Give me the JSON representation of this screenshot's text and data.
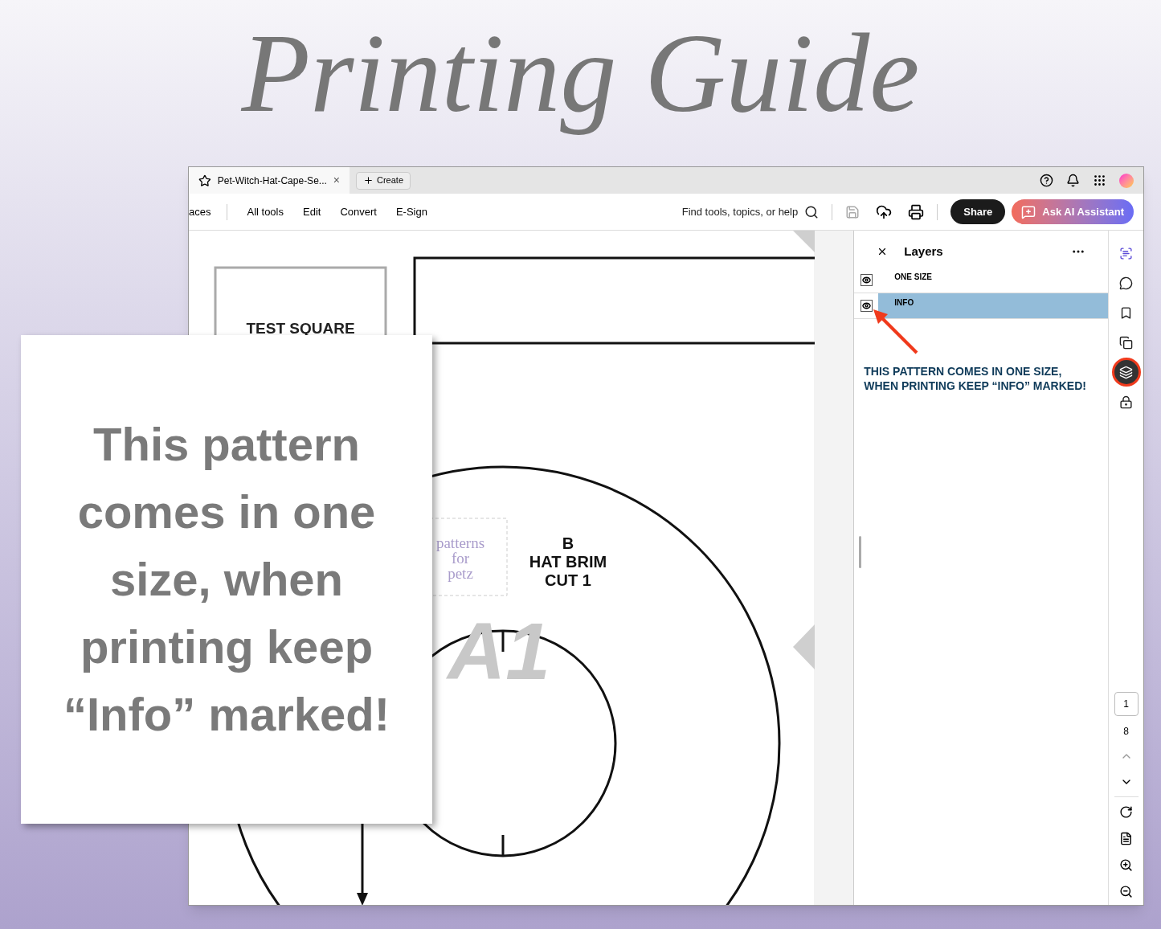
{
  "title": "Printing Guide",
  "window": {
    "tab": {
      "title": "Pet-Witch-Hat-Cape-Se...",
      "close": "×"
    },
    "create_button": "Create",
    "menu": [
      "aces",
      "All tools",
      "Edit",
      "Convert",
      "E-Sign"
    ],
    "search": {
      "placeholder": "Find tools, topics, or help"
    },
    "share_button": "Share",
    "ai_button": "Ask AI Assistant"
  },
  "document": {
    "test_square": "TEST SQUARE",
    "piece_letter": "B",
    "piece_name": "HAT BRIM",
    "piece_cut": "CUT 1",
    "logo": [
      "patterns",
      "for",
      "petz"
    ],
    "watermark": "A1"
  },
  "layers_panel": {
    "title": "Layers",
    "layers": [
      {
        "name": "ONE SIZE",
        "visible": true,
        "selected": false
      },
      {
        "name": "INFO",
        "visible": true,
        "selected": true
      }
    ]
  },
  "annotation": "THIS PATTERN COMES IN ONE SIZE, WHEN PRINTING KEEP “INFO” MARKED!",
  "rail_tools": [
    {
      "kind": "ai",
      "selected": false
    },
    {
      "kind": "comment",
      "selected": false
    },
    {
      "kind": "bookmark",
      "selected": false
    },
    {
      "kind": "pages",
      "selected": false
    },
    {
      "kind": "layers",
      "selected": true
    },
    {
      "kind": "lock",
      "selected": false
    }
  ],
  "page_nav": {
    "current_page": "1",
    "total_pages": "8"
  },
  "callout": "This pattern comes in one size, when printing keep “Info” marked!"
}
